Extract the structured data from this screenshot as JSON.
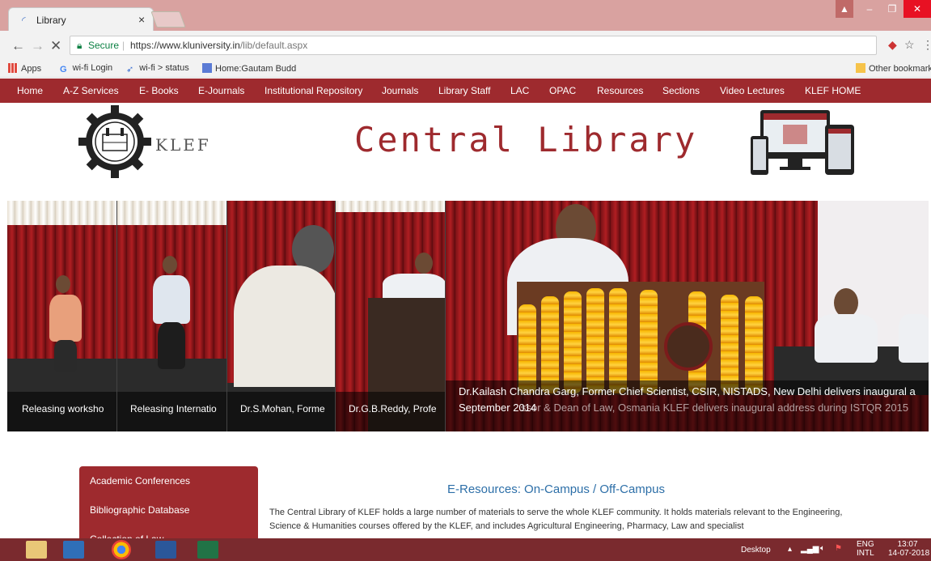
{
  "browser": {
    "tab_title": "Library",
    "tab_close": "×",
    "address": {
      "secure_label": "Secure",
      "url_host": "https://www.kluniversity.in",
      "url_path": "/lib/default.aspx"
    },
    "bookmarks": {
      "apps": "Apps",
      "items": [
        "wi-fi Login",
        "wi-fi > status",
        "Home:Gautam Budd"
      ],
      "other": "Other bookmark"
    }
  },
  "site": {
    "nav": [
      "Home",
      "A-Z Services",
      "E- Books",
      "E-Journals",
      "Institutional Repository",
      "Journals",
      "Library Staff",
      "LAC",
      "OPAC",
      "Resources",
      "Sections",
      "Video Lectures",
      "KLEF HOME"
    ],
    "brand": "KLEF",
    "title": "Central Library",
    "slides": [
      {
        "caption": "Releasing worksho"
      },
      {
        "caption": "Releasing Internatio"
      },
      {
        "caption": "Dr.S.Mohan, Forme"
      },
      {
        "caption": "Dr.G.B.Reddy, Profe"
      }
    ],
    "main_slide": {
      "line1": "Dr.Kailash Chandra Garg, Former Chief Scientist, CSIR, NISTADS, New Delhi delivers inaugural a",
      "line2": "September 2014",
      "line2_ghost": "ssor & Dean of Law, Osmania KLEF delivers inaugural address during ISTQR 2015"
    },
    "sidebar_menu": [
      "Academic Conferences",
      "Bibliographic Database",
      "Collection of Law..."
    ],
    "eresources": {
      "title": "E-Resources: On-Campus / Off-Campus",
      "text": "The Central Library of KLEF holds a large number of materials to serve the whole KLEF community. It holds materials relevant to the Engineering, Science & Humanities courses offered by the KLEF, and includes Agricultural Engineering, Pharmacy, Law and specialist"
    }
  },
  "taskbar": {
    "desktop": "Desktop",
    "lang1": "ENG",
    "lang2": "INTL",
    "time": "13:07",
    "date": "14-07-2018"
  }
}
